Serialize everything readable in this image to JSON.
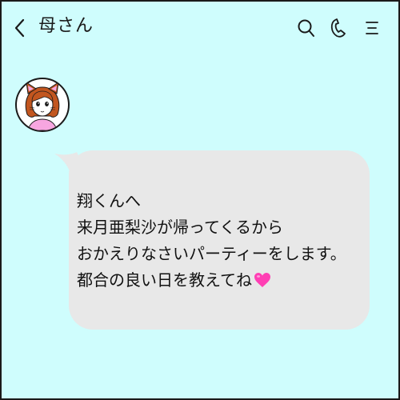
{
  "header": {
    "title": "母さん",
    "icons": [
      "back-arrow-icon",
      "search-icon",
      "phone-icon",
      "menu-icon"
    ]
  },
  "message": {
    "lines": [
      "翔くんへ",
      "来月亜梨沙が帰ってくるから",
      "おかえりなさいパーティーをします。",
      "都合の良い日を教えてね"
    ],
    "emoji": "pink-heart"
  },
  "colors": {
    "background": "#cffdfd",
    "bubble": "#e8e8e8",
    "heart": "#ff3fb4"
  }
}
